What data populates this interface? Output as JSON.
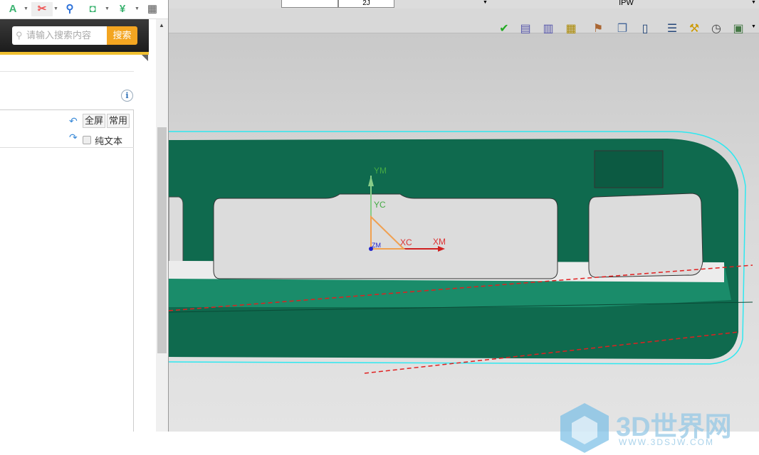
{
  "browser_toolbar": {
    "icons": [
      "translate-icon",
      "scissors-icon",
      "search-icon",
      "gamepad-icon",
      "shield-yen-icon",
      "apps-icon"
    ]
  },
  "search": {
    "placeholder": "请输入搜索内容",
    "button": "搜索"
  },
  "editor": {
    "fullscreen": "全屏",
    "common": "常用",
    "plain_text": "纯文本",
    "info": "i"
  },
  "nx": {
    "field2": "2J",
    "field3": "IPW",
    "view_labels": {
      "ym": "YM",
      "yc": "YC",
      "xc": "XC",
      "xm": "XM",
      "zm": "ZM"
    }
  },
  "watermark": {
    "title": "3D世界网",
    "url": "WWW.3DSJW.COM"
  },
  "colors": {
    "accent": "#f3a521",
    "model_green": "#0f6a4e",
    "cyan": "#2ee8f0"
  }
}
